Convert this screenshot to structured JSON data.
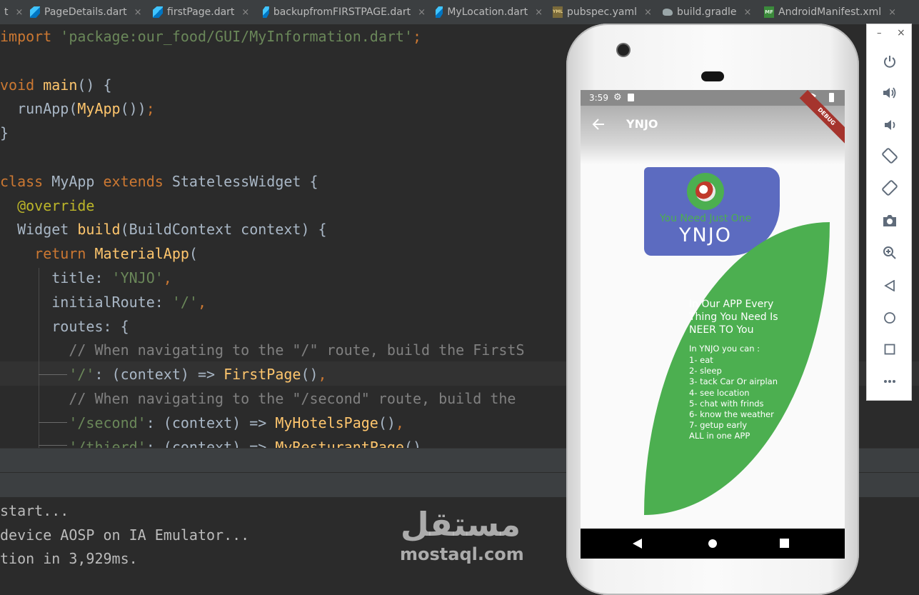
{
  "tabs": [
    {
      "label": "t",
      "icon": "dart-file-icon",
      "kind": "partial"
    },
    {
      "label": "PageDetails.dart",
      "icon": "dart-file-icon",
      "kind": "dart"
    },
    {
      "label": "firstPage.dart",
      "icon": "dart-file-icon",
      "kind": "dart"
    },
    {
      "label": "backupfromFIRSTPAGE.dart",
      "icon": "dart-file-icon",
      "kind": "dart"
    },
    {
      "label": "MyLocation.dart",
      "icon": "dart-file-icon",
      "kind": "dart"
    },
    {
      "label": "pubspec.yaml",
      "icon": "yaml-file-icon",
      "kind": "yml"
    },
    {
      "label": "build.gradle",
      "icon": "gradle-file-icon",
      "kind": "gradle"
    },
    {
      "label": "AndroidManifest.xml",
      "icon": "manifest-file-icon",
      "kind": "mf"
    }
  ],
  "tab_close_glyph": "×",
  "code_lines": [
    [
      [
        "kw",
        "import "
      ],
      [
        "st",
        "'package:our_food/GUI/MyInformation.dart'"
      ],
      [
        "kw",
        ";"
      ]
    ],
    [],
    [
      [
        "kw",
        "void "
      ],
      [
        "fn",
        "main"
      ],
      [
        "pl",
        "() {"
      ]
    ],
    [
      [
        "pl",
        "  runApp("
      ],
      [
        "fn",
        "MyApp"
      ],
      [
        "pl",
        "())"
      ],
      [
        "kw",
        ";"
      ]
    ],
    [
      [
        "pl",
        "}"
      ]
    ],
    [],
    [
      [
        "kw",
        "class "
      ],
      [
        "pl",
        "MyApp "
      ],
      [
        "kw",
        "extends "
      ],
      [
        "pl",
        "StatelessWidget {"
      ]
    ],
    [
      [
        "an",
        "  @override"
      ]
    ],
    [
      [
        "pl",
        "  Widget "
      ],
      [
        "fn",
        "build"
      ],
      [
        "pl",
        "(BuildContext context) {"
      ]
    ],
    [
      [
        "kw",
        "    return "
      ],
      [
        "fn",
        "MaterialApp"
      ],
      [
        "pl",
        "("
      ]
    ],
    [
      [
        "pl",
        "      title: "
      ],
      [
        "st",
        "'YNJO'"
      ],
      [
        "kw",
        ","
      ]
    ],
    [
      [
        "pl",
        "      initialRoute: "
      ],
      [
        "st",
        "'/'"
      ],
      [
        "kw",
        ","
      ]
    ],
    [
      [
        "pl",
        "      routes: {"
      ]
    ],
    [
      [
        "cm",
        "        // When navigating to the \"/\" route, build the FirstS"
      ]
    ],
    [
      [
        "st",
        "        '/'"
      ],
      [
        "pl",
        ": (context) => "
      ],
      [
        "fn",
        "FirstPage"
      ],
      [
        "pl",
        "()"
      ],
      [
        "kw",
        ","
      ]
    ],
    [
      [
        "cm",
        "        // When navigating to the \"/second\" route, build the"
      ]
    ],
    [
      [
        "st",
        "        '/second'"
      ],
      [
        "pl",
        ": (context) => "
      ],
      [
        "fn",
        "MyHotelsPage"
      ],
      [
        "pl",
        "()"
      ],
      [
        "kw",
        ","
      ]
    ],
    [
      [
        "st",
        "        '/thierd'"
      ],
      [
        "pl",
        ": (context) => "
      ],
      [
        "fn",
        "MyResturantPage"
      ],
      [
        "pl",
        "()"
      ]
    ]
  ],
  "console_lines": [
    "start...",
    "device AOSP on IA Emulator...",
    "tion in 3,929ms."
  ],
  "watermark": {
    "arabic": "مستقل",
    "latin": "mostaql.com"
  },
  "device": {
    "status_time": "3:59",
    "debug_banner": "DEBUG",
    "app_title": "YNJO",
    "back_icon": "arrow-back-icon",
    "tagline": "You Need Just One",
    "brand": "YNJO",
    "heading": "In Our APP Every Thing You Need Is NEER TO You",
    "list_title": "In YNJO you can :",
    "list_items": [
      "1- eat",
      "2- sleep",
      "3- tack Car Or airplan",
      "4- see location",
      "5- chat with frinds",
      "6- know the weather",
      "7- getup early",
      "ALL in one APP"
    ]
  },
  "emulator_toolbar": [
    {
      "name": "power-icon"
    },
    {
      "name": "volume-up-icon"
    },
    {
      "name": "volume-down-icon"
    },
    {
      "name": "rotate-left-icon"
    },
    {
      "name": "rotate-right-icon"
    },
    {
      "name": "screenshot-camera-icon"
    },
    {
      "name": "zoom-icon"
    },
    {
      "name": "back-triangle-icon"
    },
    {
      "name": "home-circle-icon"
    },
    {
      "name": "overview-square-icon"
    },
    {
      "name": "more-icon"
    }
  ],
  "emulator_window": {
    "minimize": "–",
    "close": "×"
  },
  "colors": {
    "editor_bg": "#2b2b2b",
    "keyword": "#cc7832",
    "string": "#6a8759",
    "function": "#ffc66d",
    "comment": "#808080",
    "annotation": "#bbb529",
    "card_purple": "#5c6bc0",
    "leaf_green": "#4caf50",
    "tagline_green": "#4caf50"
  }
}
